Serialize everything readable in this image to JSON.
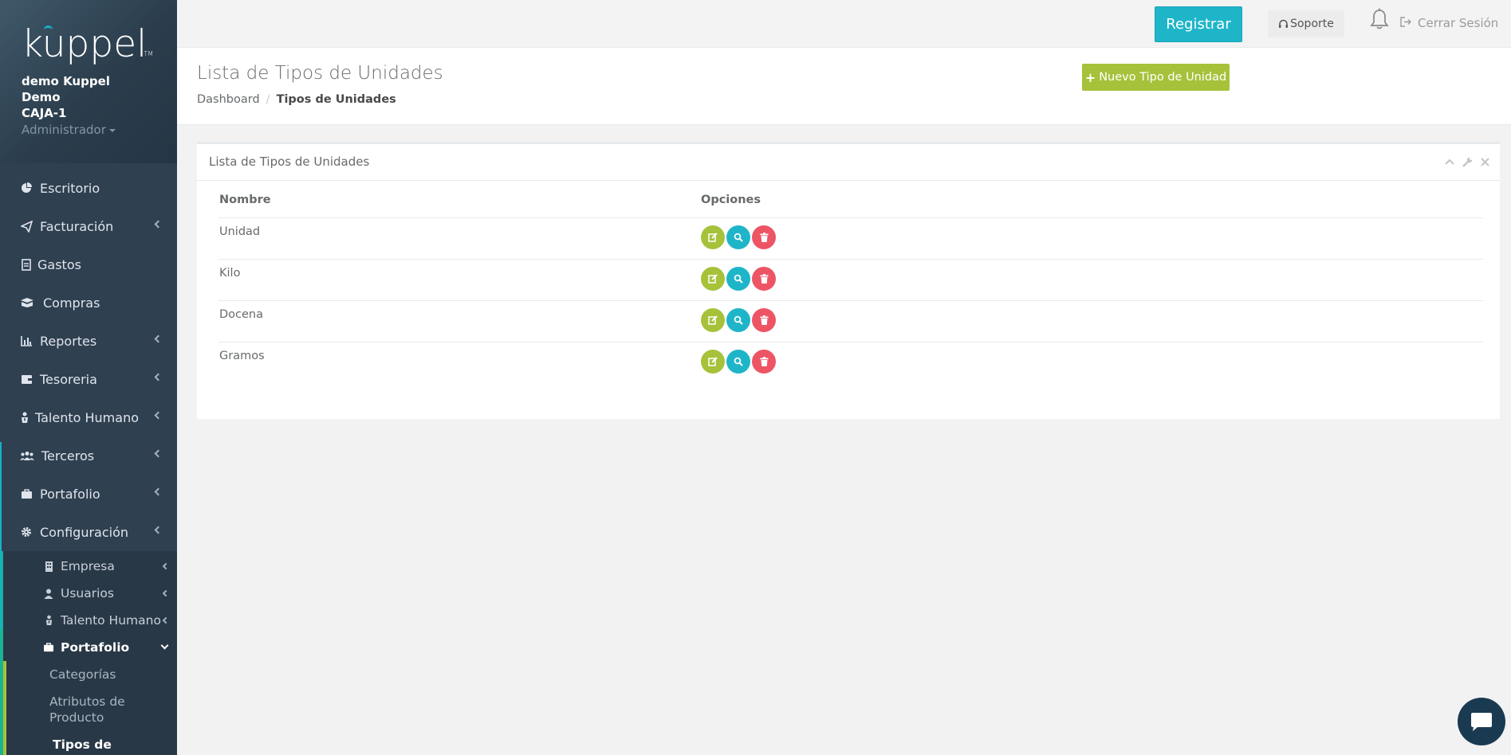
{
  "brand": {
    "logo_text": "kuppel",
    "tm": "TM",
    "accent": "#1ab0c9"
  },
  "profile": {
    "company": "demo Kuppel",
    "name": "Demo",
    "register": "CAJA-1",
    "role": "Administrador"
  },
  "sidebar": {
    "items": [
      {
        "label": "Escritorio",
        "icon": "pie-chart-icon",
        "has_children": false
      },
      {
        "label": "Facturación",
        "icon": "paper-plane-icon",
        "has_children": true
      },
      {
        "label": "Gastos",
        "icon": "document-icon",
        "has_children": false
      },
      {
        "label": "Compras",
        "icon": "box-icon",
        "has_children": false
      },
      {
        "label": "Reportes",
        "icon": "bar-chart-icon",
        "has_children": true
      },
      {
        "label": "Tesoreria",
        "icon": "wallet-icon",
        "has_children": true
      },
      {
        "label": "Talento Humano",
        "icon": "person-tie-icon",
        "has_children": true
      },
      {
        "label": "Terceros",
        "icon": "users-icon",
        "has_children": true
      },
      {
        "label": "Portafolio",
        "icon": "briefcase-icon",
        "has_children": true
      },
      {
        "label": "Configuración",
        "icon": "gear-icon",
        "has_children": true
      }
    ],
    "config_sub": [
      {
        "label": "Empresa",
        "icon": "building-icon"
      },
      {
        "label": "Usuarios",
        "icon": "user-icon"
      },
      {
        "label": "Talento Humano",
        "icon": "person-tie-icon"
      },
      {
        "label": "Portafolio",
        "icon": "briefcase-icon"
      }
    ],
    "portafolio_sub": [
      "Categorías",
      "Atributos de Producto",
      "Tipos de Unidades"
    ]
  },
  "topbar": {
    "register_label": "Registrar",
    "support_label": "Soporte",
    "logout_label": "Cerrar Sesión"
  },
  "heading": {
    "title": "Lista de Tipos de Unidades",
    "breadcrumb": [
      "Dashboard",
      "Tipos de Unidades"
    ],
    "new_button": "Nuevo Tipo de Unidad"
  },
  "panel": {
    "title": "Lista de Tipos de Unidades",
    "columns": [
      "Nombre",
      "Opciones"
    ],
    "rows": [
      "Unidad",
      "Kilo",
      "Docena",
      "Gramos"
    ]
  },
  "colors": {
    "sidebar": "#2f4050",
    "green": "#a6c23a",
    "cyan": "#1fb5c9",
    "red": "#ed5565"
  }
}
